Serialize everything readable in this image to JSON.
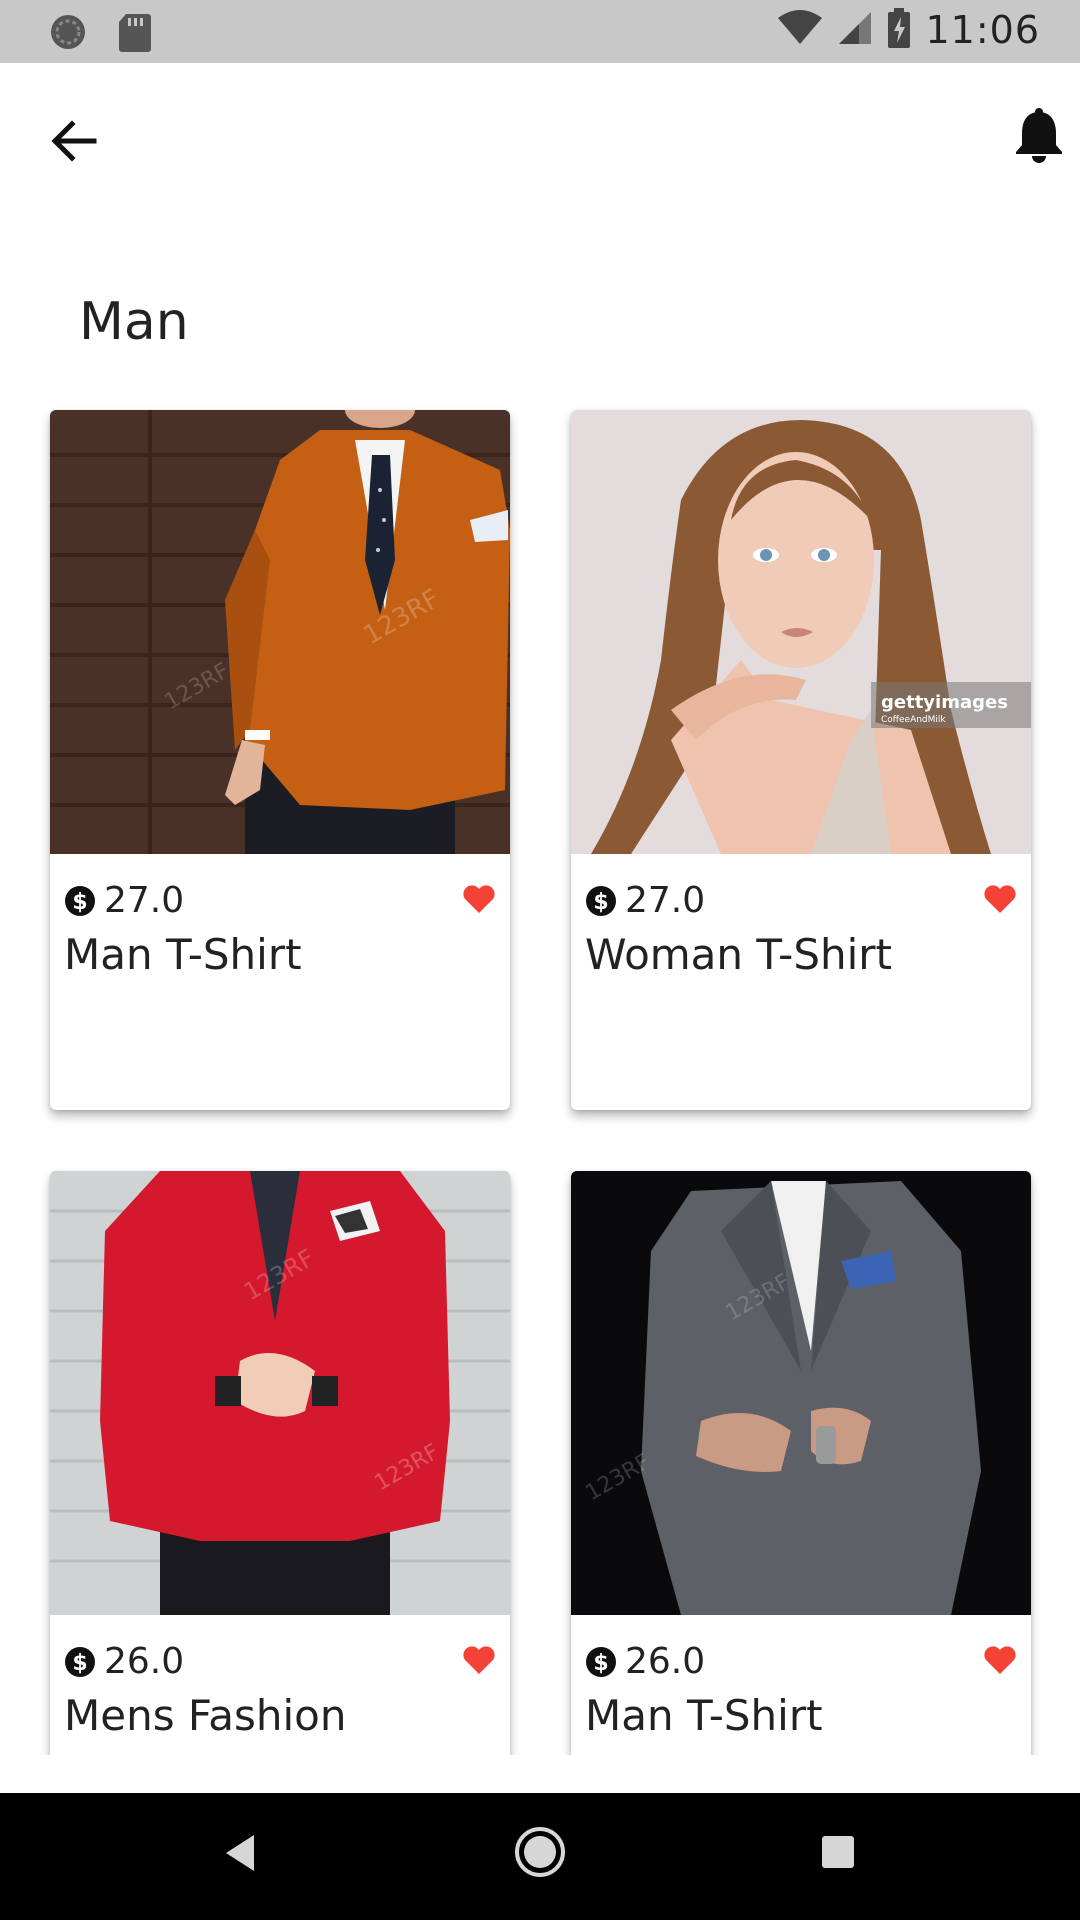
{
  "status_bar": {
    "time": "11:06",
    "icons": [
      "sync-circle-icon",
      "sd-card-icon",
      "wifi-icon",
      "cell-signal-icon",
      "battery-charging-icon"
    ]
  },
  "app_bar": {
    "back_icon": "arrow-left-icon",
    "notification_icon": "bell-icon"
  },
  "page": {
    "title": "Man"
  },
  "colors": {
    "favorite": "#f44336",
    "status_bar": "#c8c8c8",
    "nav_bar": "#000000"
  },
  "products": [
    {
      "price": "27.0",
      "name": "Man T-Shirt",
      "currency_icon": "dollar-circle-icon",
      "favorite_icon": "heart-icon",
      "image": "man-orange-blazer"
    },
    {
      "price": "27.0",
      "name": "Woman T-Shirt",
      "currency_icon": "dollar-circle-icon",
      "favorite_icon": "heart-icon",
      "image": "woman-portrait"
    },
    {
      "price": "26.0",
      "name": "Mens Fashion",
      "currency_icon": "dollar-circle-icon",
      "favorite_icon": "heart-icon",
      "image": "man-red-blazer"
    },
    {
      "price": "26.0",
      "name": "Man T-Shirt",
      "currency_icon": "dollar-circle-icon",
      "favorite_icon": "heart-icon",
      "image": "man-grey-suit"
    }
  ],
  "nav_bar": {
    "icons": [
      "back-triangle-icon",
      "home-circle-icon",
      "recents-square-icon"
    ]
  }
}
